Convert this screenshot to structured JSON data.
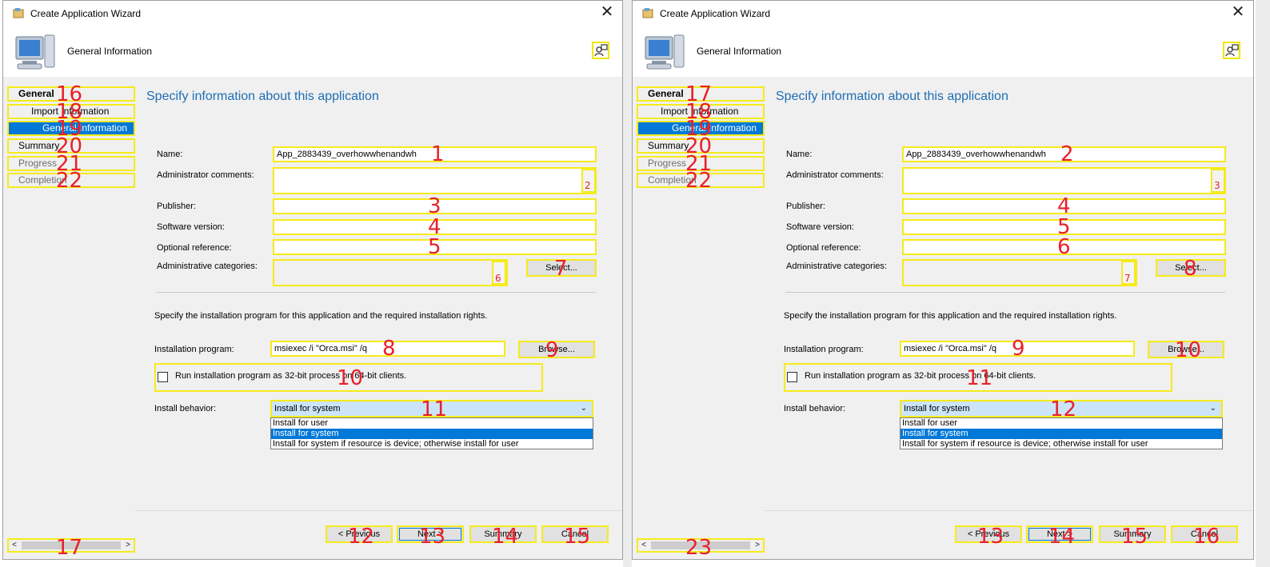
{
  "panels": [
    {
      "window_title": "Create Application Wizard",
      "header_title": "General Information",
      "content_title": "Specify information about this application",
      "nav": {
        "items": [
          {
            "label": "General",
            "marker": "16"
          },
          {
            "label": "Import Information",
            "marker": "18"
          },
          {
            "label": "General Information",
            "marker": "19"
          },
          {
            "label": "Summary",
            "marker": "20"
          },
          {
            "label": "Progress",
            "marker": "21"
          },
          {
            "label": "Completion",
            "marker": "22"
          }
        ],
        "scroll_marker": "17"
      },
      "form": {
        "name_label": "Name:",
        "name_value": "App_2883439_overhowwhenandwh",
        "admin_comments_label": "Administrator comments:",
        "publisher_label": "Publisher:",
        "software_version_label": "Software version:",
        "optional_reference_label": "Optional reference:",
        "admin_categories_label": "Administrative categories:",
        "select_button": "Select...",
        "install_desc": "Specify the installation program for this application and the required installation rights.",
        "install_program_label": "Installation program:",
        "install_program_value": "msiexec /i \"Orca.msi\" /q",
        "browse_button": "Browse...",
        "checkbox_label": "Run installation program as 32-bit process on 64-bit clients.",
        "install_behavior_label": "Install behavior:",
        "install_behavior_value": "Install for system",
        "install_behavior_options": [
          "Install for user",
          "Install for system",
          "Install for system if resource is device; otherwise install for user"
        ]
      },
      "buttons": {
        "previous": "< Previous",
        "next": "Next >",
        "summary": "Summary",
        "cancel": "Cancel"
      },
      "markers": {
        "name": "1",
        "comments_spin": "2",
        "publisher": "3",
        "version": "4",
        "reference": "5",
        "categories_spin": "6",
        "select": "7",
        "program": "8",
        "browse": "9",
        "checkbox": "10",
        "behavior": "11",
        "previous": "12",
        "next": "13",
        "summary": "14",
        "cancel": "15"
      }
    },
    {
      "window_title": "Create Application Wizard",
      "header_title": "General Information",
      "content_title": "Specify information about this application",
      "nav": {
        "items": [
          {
            "label": "General",
            "marker": "17"
          },
          {
            "label": "Import Information",
            "marker": "18"
          },
          {
            "label": "General Information",
            "marker": "19"
          },
          {
            "label": "Summary",
            "marker": "20"
          },
          {
            "label": "Progress",
            "marker": "21"
          },
          {
            "label": "Completion",
            "marker": "22"
          }
        ],
        "scroll_marker": "23"
      },
      "form": {
        "name_label": "Name:",
        "name_value": "App_2883439_overhowwhenandwh",
        "admin_comments_label": "Administrator comments:",
        "publisher_label": "Publisher:",
        "software_version_label": "Software version:",
        "optional_reference_label": "Optional reference:",
        "admin_categories_label": "Administrative categories:",
        "select_button": "Select...",
        "install_desc": "Specify the installation program for this application and the required installation rights.",
        "install_program_label": "Installation program:",
        "install_program_value": "msiexec /i \"Orca.msi\" /q",
        "browse_button": "Browse...",
        "checkbox_label": "Run installation program as 32-bit process on 64-bit clients.",
        "install_behavior_label": "Install behavior:",
        "install_behavior_value": "Install for system",
        "install_behavior_options": [
          "Install for user",
          "Install for system",
          "Install for system if resource is device; otherwise install for user"
        ]
      },
      "buttons": {
        "previous": "< Previous",
        "next": "Next >",
        "summary": "Summary",
        "cancel": "Cancel"
      },
      "markers": {
        "name": "2",
        "comments_spin": "3",
        "publisher": "4",
        "version": "5",
        "reference": "6",
        "categories_spin": "7",
        "select": "8",
        "program": "9",
        "browse": "10",
        "checkbox": "11",
        "behavior": "12",
        "previous": "13",
        "next": "14",
        "summary": "15",
        "cancel": "16"
      }
    }
  ],
  "colors": {
    "accent": "#0078d7",
    "annotation": "#f5eb1b",
    "marker_text": "#e8202a",
    "title_blue": "#1e6eb3"
  }
}
